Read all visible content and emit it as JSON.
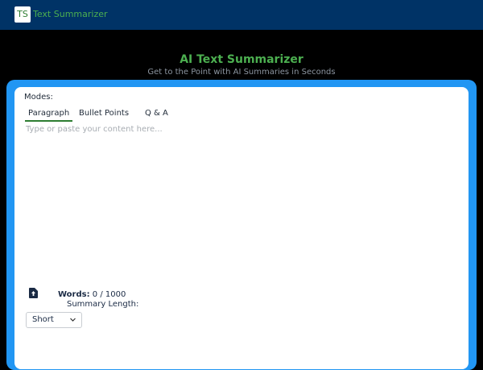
{
  "header": {
    "logo_text": "TS",
    "app_title": "Text Summarizer"
  },
  "hero": {
    "title": "AI Text Summarizer",
    "subtitle": "Get to the Point with AI Summaries in Seconds"
  },
  "editor": {
    "modes_label": "Modes:",
    "tabs": [
      {
        "label": "Paragraph",
        "active": true
      },
      {
        "label": "Bullet Points",
        "active": false
      },
      {
        "label": "Q & A",
        "active": false
      }
    ],
    "placeholder": "Type or paste your content here...",
    "value": "",
    "upload_icon": "file-upload-icon",
    "words_label": "Words:",
    "words_count": "0 / 1000",
    "summary_length_label": "Summary Length:",
    "summary_length_value": "Short"
  },
  "colors": {
    "header_bg": "#003366",
    "accent_green": "#4caf50",
    "card_border": "#2196f3",
    "page_bg": "#000000"
  }
}
